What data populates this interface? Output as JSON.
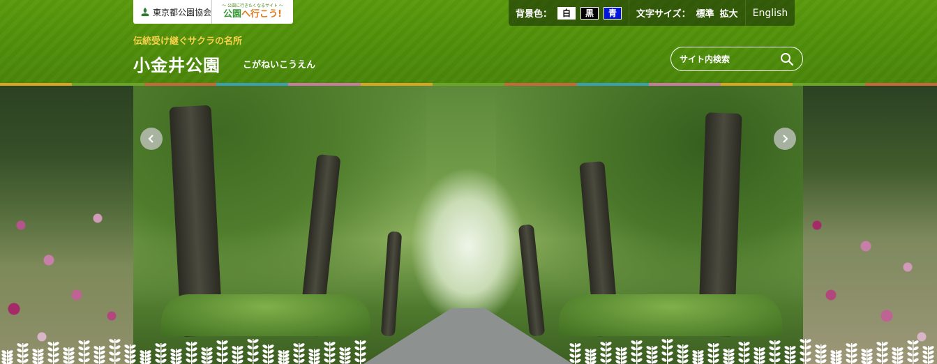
{
  "header": {
    "org_logo_text": "東京都公園協会",
    "promo_logo_small": "～ 公園に行きたくなるサイト ～",
    "promo_logo_big_a": "公園",
    "promo_logo_big_b": "へ行こう!",
    "tagline": "伝統受け継ぐサクラの名所",
    "title": "小金井公園",
    "reading": "こがねいこうえん"
  },
  "toolbar": {
    "bg_label": "背景色：",
    "bg_white": "白",
    "bg_black": "黒",
    "bg_blue": "青",
    "font_label": "文字サイズ：",
    "font_normal": "標準",
    "font_large": "拡大",
    "english": "English"
  },
  "search": {
    "placeholder": "サイト内検索"
  },
  "colors": {
    "header_green": "#4f8e0a",
    "tagline_yellow": "#f6d24a",
    "stripe": [
      "#d9a520",
      "#6aa52a",
      "#c8683a",
      "#3a9fb0",
      "#c87aa0",
      "#d9a520",
      "#6aa52a",
      "#c8683a",
      "#3a9fb0",
      "#c87aa0",
      "#d9a520",
      "#6aa52a",
      "#c8683a"
    ]
  },
  "slider": {
    "prev_icon": "chevron-left-icon",
    "next_icon": "chevron-right-icon"
  }
}
